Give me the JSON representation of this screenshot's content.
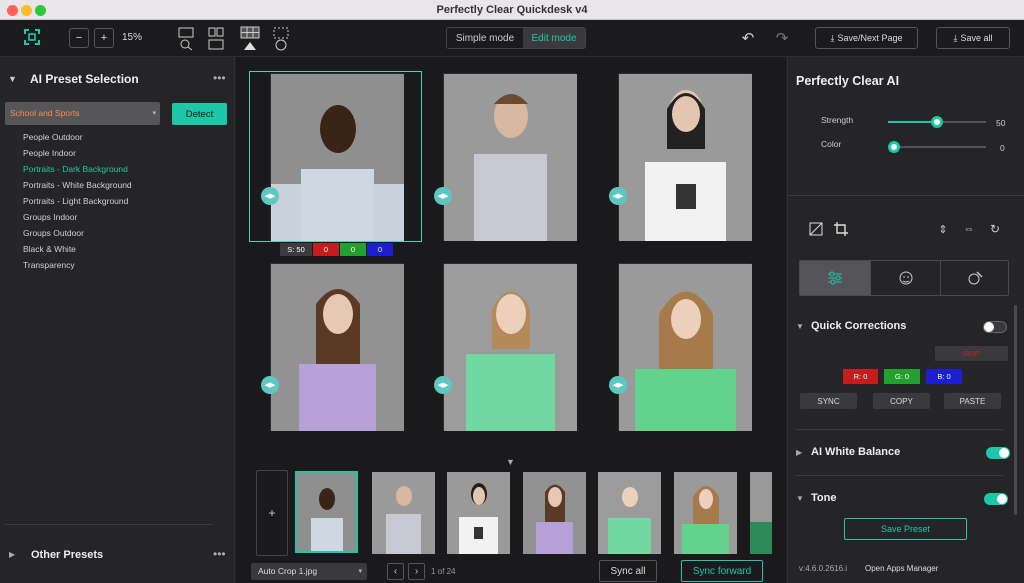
{
  "window": {
    "title": "Perfectly Clear Quickdesk v4"
  },
  "toolbar": {
    "zoom": "15%",
    "simple_mode": "Simple mode",
    "edit_mode": "Edit mode",
    "save_next": "Save/Next Page",
    "save_all": "Save all"
  },
  "left": {
    "ai_preset_title": "AI Preset Selection",
    "dropdown_value": "School and Sports",
    "detect": "Detect",
    "presets": [
      "People Outdoor",
      "People Indoor",
      "Portraits - Dark Background",
      "Portraits - White Background",
      "Portraits - Light Background",
      "Groups Indoor",
      "Groups Outdoor",
      "Black & White",
      "Transparency"
    ],
    "active_preset": "Portraits - Dark Background",
    "other_presets": "Other Presets"
  },
  "grid": {
    "s_badge": "S: 50",
    "r": "0",
    "g": "0",
    "b": "0"
  },
  "bottom": {
    "filename": "Auto Crop 1.jpg",
    "page": "1 of 24",
    "sync_all": "Sync all",
    "sync_forward": "Sync forward",
    "add": "+"
  },
  "right": {
    "title": "Perfectly Clear AI",
    "strength_label": "Strength",
    "strength_value": "50",
    "strength_level": 0.5,
    "color_label": "Color",
    "color_value": "0",
    "color_level": 0,
    "quick_corrections": "Quick Corrections",
    "skip": "SKIP",
    "r_label": "R: 0",
    "g_label": "G: 0",
    "b_label": "B: 0",
    "sync": "SYNC",
    "copy": "COPY",
    "paste": "PASTE",
    "white_balance": "AI White Balance",
    "tone": "Tone",
    "save_preset": "Save Preset",
    "version": "v:4.6.0.2616.i",
    "apps_manager": "Open Apps Manager"
  },
  "colors": {
    "accent": "#1dc8a8",
    "teal": "#5cc8c0"
  }
}
